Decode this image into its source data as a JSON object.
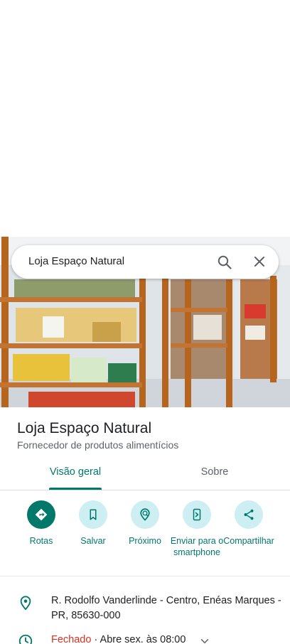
{
  "search": {
    "query": "Loja Espaço Natural"
  },
  "place": {
    "name": "Loja Espaço Natural",
    "category": "Fornecedor de produtos alimentícios"
  },
  "tabs": [
    {
      "label": "Visão geral",
      "selected": true
    },
    {
      "label": "Sobre",
      "selected": false
    }
  ],
  "actions": [
    {
      "label": "Rotas",
      "icon": "directions-icon"
    },
    {
      "label": "Salvar",
      "icon": "bookmark-icon"
    },
    {
      "label": "Próximo",
      "icon": "nearby-icon"
    },
    {
      "label": "Enviar para o smartphone",
      "icon": "send-to-phone-icon"
    },
    {
      "label": "Compartilhar",
      "icon": "share-icon"
    }
  ],
  "details": {
    "address": "R. Rodolfo Vanderlinde - Centro, Enéas Marques - PR, 85630-000",
    "hours_status": "Fechado",
    "hours_rest": " · Abre sex. às 08:00"
  },
  "colors": {
    "accent": "#00796b",
    "action_bg": "#cdeef2",
    "closed": "#d93025"
  }
}
